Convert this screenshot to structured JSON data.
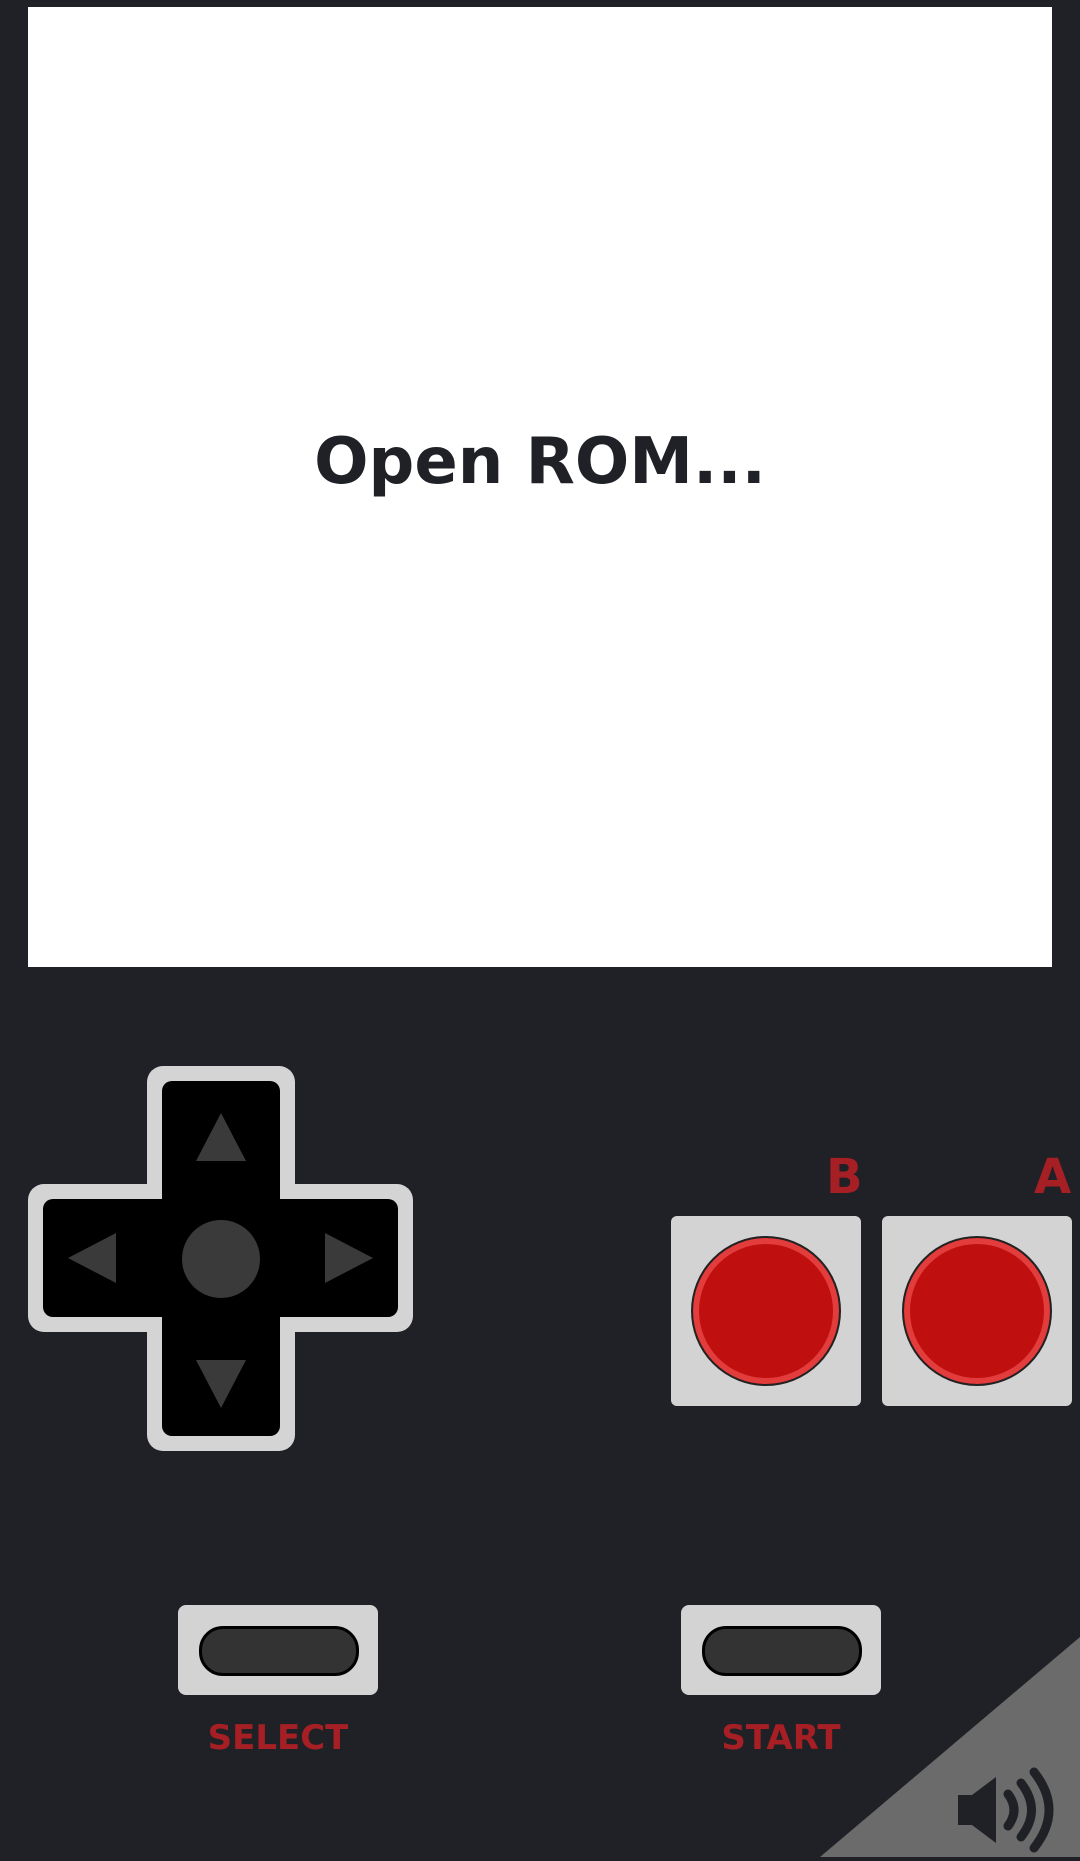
{
  "screen": {
    "label": "Open ROM..."
  },
  "buttons": {
    "b_label": "B",
    "a_label": "A",
    "select_label": "SELECT",
    "start_label": "START"
  },
  "colors": {
    "background": "#1f2126",
    "screen": "#ffffff",
    "accent_red": "#a61f24",
    "button_red": "#bf0f0f",
    "pad_gray": "#d3d3d3"
  },
  "icons": {
    "sound": "speaker-volume-icon"
  }
}
